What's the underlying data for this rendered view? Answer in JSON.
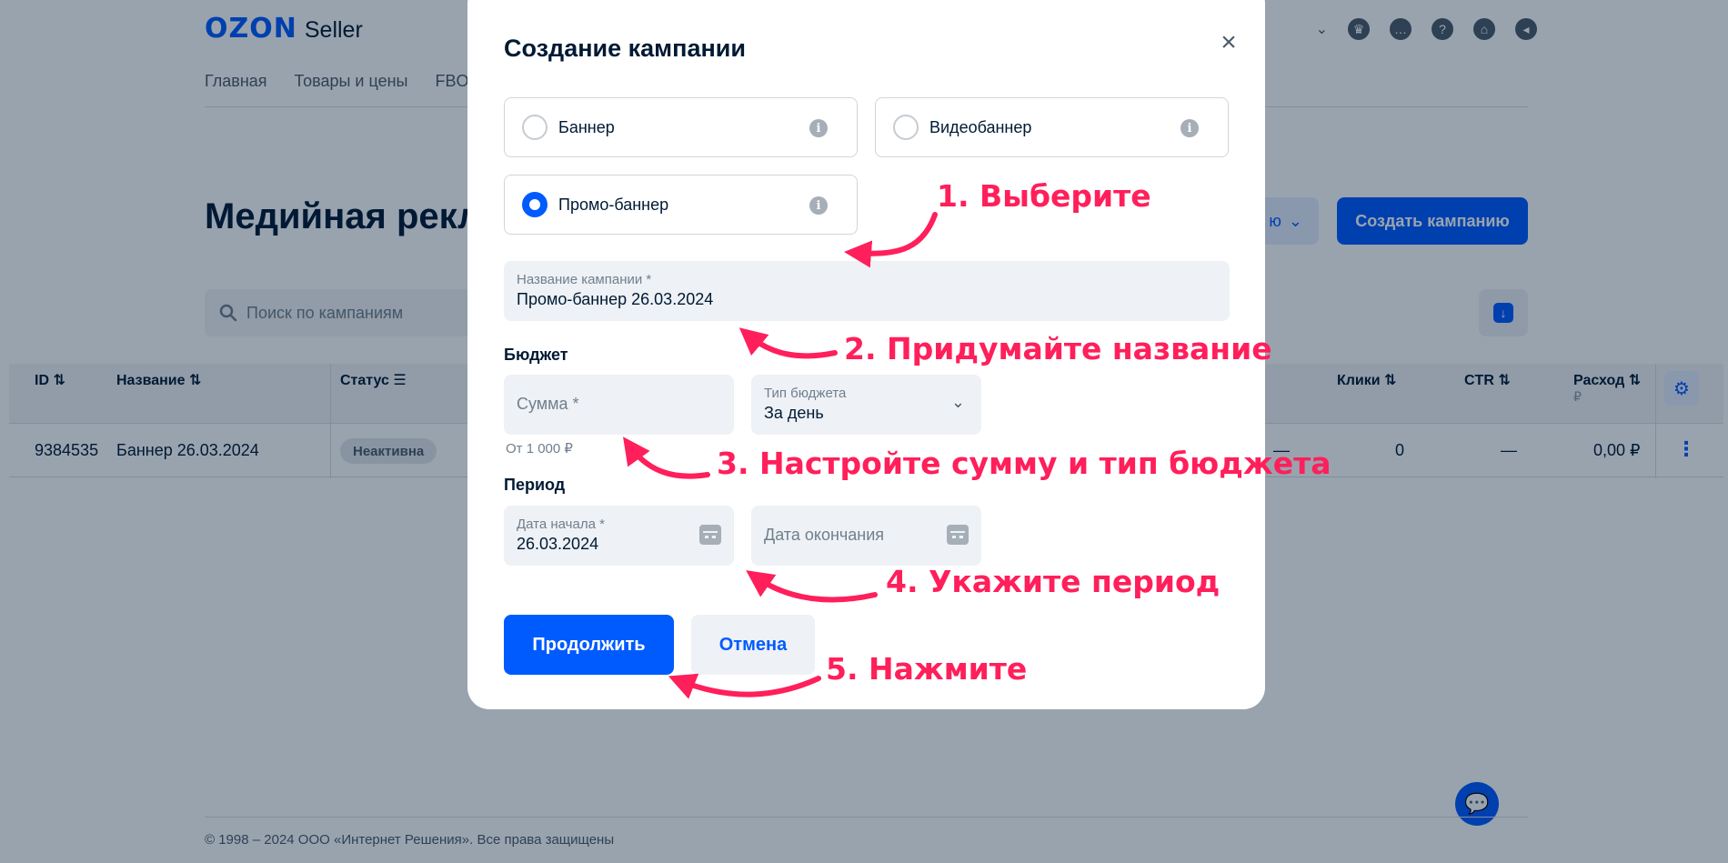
{
  "app": {
    "logo_brand": "OZON",
    "logo_product": "Seller",
    "nav": [
      "Главная",
      "Товары и цены",
      "FBO"
    ],
    "page_title": "Медийная рекл",
    "filter_label": "ю",
    "create_button": "Создать кампанию",
    "search_placeholder": "Поиск по кампаниям",
    "table": {
      "headers": {
        "id": "ID",
        "name": "Название",
        "status": "Статус",
        "hidden": "",
        "clicks": "Клики",
        "ctr": "CTR",
        "spend": "Расход",
        "spend_unit": "₽"
      },
      "row": {
        "id": "9384535",
        "name": "Баннер 26.03.2024",
        "status": "Неактивна",
        "hidden_value": "—",
        "clicks": "0",
        "ctr": "—",
        "spend": "0,00 ₽"
      }
    },
    "footer": "© 1998 – 2024 ООО «Интернет Решения». Все права защищены"
  },
  "modal": {
    "title": "Создание кампании",
    "types": [
      {
        "label": "Баннер",
        "checked": false
      },
      {
        "label": "Видеобаннер",
        "checked": false
      },
      {
        "label": "Промо-баннер",
        "checked": true
      }
    ],
    "campaign_name": {
      "label": "Название кампании *",
      "value": "Промо-баннер 26.03.2024"
    },
    "budget_section": "Бюджет",
    "amount": {
      "placeholder": "Сумма *",
      "hint": "От 1 000 ₽"
    },
    "budget_type": {
      "label": "Тип бюджета",
      "value": "За день"
    },
    "period_section": "Период",
    "start_date": {
      "label": "Дата начала *",
      "value": "26.03.2024"
    },
    "end_date": {
      "placeholder": "Дата окончания"
    },
    "continue_button": "Продолжить",
    "cancel_button": "Отмена"
  },
  "annotations": [
    "1. Выберите",
    "2. Придумайте название",
    "3. Настройте сумму и тип бюджета",
    "4. Укажите период",
    "5. Нажмите"
  ],
  "colors": {
    "accent": "#005bff",
    "annotation": "#ff1f5a"
  }
}
